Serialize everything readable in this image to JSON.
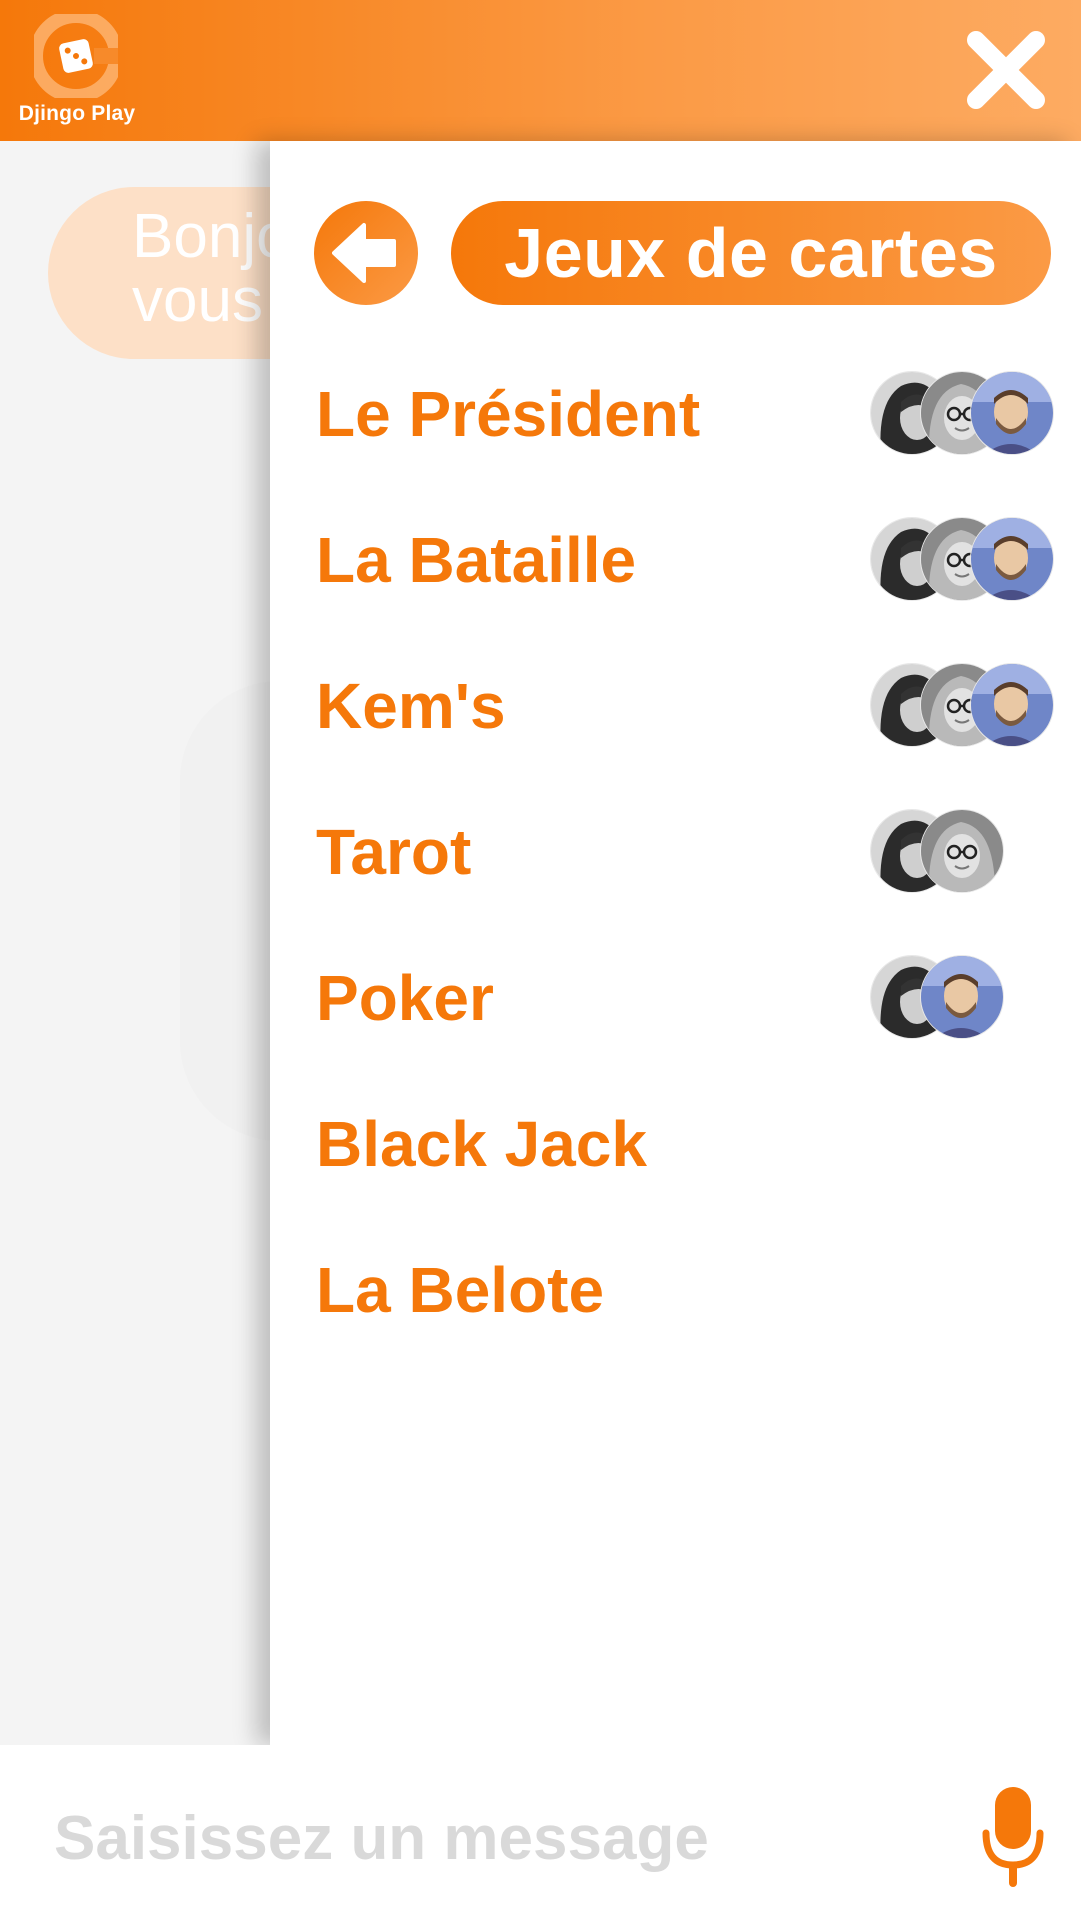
{
  "app": {
    "name": "Djingo Play"
  },
  "colors": {
    "accent": "#f5780a",
    "accent_light": "#fb9a45",
    "bubble": "#fde0c7"
  },
  "header": {
    "close_icon": "close-icon"
  },
  "background": {
    "bubble_text": "Bonjour\nvous"
  },
  "panel": {
    "title": "Jeux de cartes",
    "back_icon": "arrow-left-icon",
    "games": [
      {
        "label": "Le Président",
        "avatars": [
          "woman-dark-hair",
          "woman-glasses",
          "man-beard"
        ]
      },
      {
        "label": "La Bataille",
        "avatars": [
          "woman-dark-hair",
          "woman-glasses",
          "man-beard"
        ]
      },
      {
        "label": "Kem's",
        "avatars": [
          "woman-dark-hair",
          "woman-glasses",
          "man-beard"
        ]
      },
      {
        "label": "Tarot",
        "avatars": [
          "woman-dark-hair",
          "woman-glasses"
        ]
      },
      {
        "label": "Poker",
        "avatars": [
          "woman-dark-hair",
          "man-beard"
        ]
      },
      {
        "label": "Black Jack",
        "avatars": []
      },
      {
        "label": "La Belote",
        "avatars": []
      }
    ]
  },
  "input": {
    "placeholder": "Saisissez un message",
    "value": "",
    "mic_icon": "microphone-icon"
  }
}
